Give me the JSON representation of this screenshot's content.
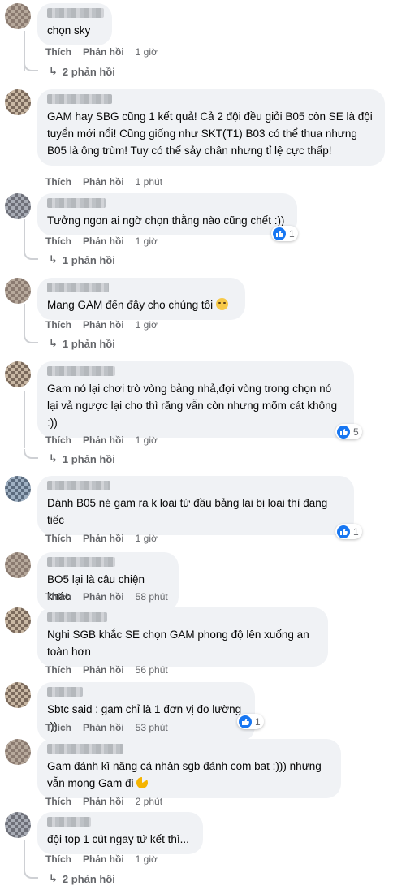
{
  "labels": {
    "like": "Thích",
    "reply": "Phản hồi"
  },
  "colors": {
    "like_blue": "#1877f2",
    "bubble_bg": "#f0f2f5",
    "meta_gray": "#65676b"
  },
  "comments": [
    {
      "text": "chọn sky",
      "time": "1 giờ",
      "replies": "2 phản hồi"
    },
    {
      "text": "GAM hay SBG cũng 1 kết quả! Cả 2 đội đều giỏi B05 còn SE là đội tuyển mới nổi! Cũng giống như SKT(T1) B03 có thể thua nhưng B05 là ông trùm! Tuy có thể sảy chân nhưng tỉ lệ cực thấp!",
      "time": "1 phút"
    },
    {
      "text": "Tưởng ngon ai ngờ chọn thằng nào cũng chết :))",
      "time": "1 giờ",
      "reactions": "1",
      "replies": "1 phản hồi"
    },
    {
      "text": "Mang GAM đến đây cho chúng tôi",
      "time": "1 giờ",
      "replies": "1 phản hồi"
    },
    {
      "text": "Gam nó lại chơi trò vòng bảng nhả,đợi vòng trong chọn nó lại vả ngược lại cho thì răng vẫn còn nhưng mõm cát không :))",
      "time": "1 giờ",
      "reactions": "5",
      "replies": "1 phản hồi"
    },
    {
      "text": "Dánh B05 né gam ra k loại từ đầu bảng lại bị loại thì đang tiếc",
      "time": "1 giờ",
      "reactions": "1"
    },
    {
      "text": "BO5 lại là câu chiện khác",
      "time": "58 phút"
    },
    {
      "text": "Nghi SGB khắc SE chọn GAM phong độ lên xuống an toàn hơn",
      "time": "56 phút"
    },
    {
      "text": "Sbtc said : gam chỉ là 1 đơn vị đo lường :))",
      "time": "53 phút",
      "reactions": "1"
    },
    {
      "text": "Gam đánh kĩ năng cá nhân sgb đánh com bat :))) nhưng vẫn mong Gam đi",
      "time": "2 phút"
    },
    {
      "text": "đội top 1 cút ngay tứ kết thì...",
      "time": "1 giờ",
      "replies": "2 phản hồi"
    }
  ]
}
